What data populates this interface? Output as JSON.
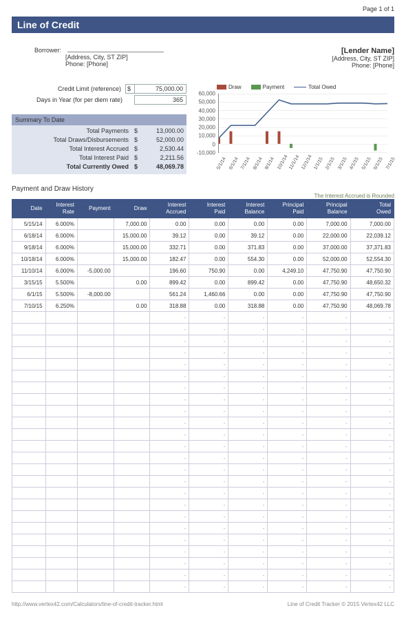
{
  "page_indicator": "Page 1 of 1",
  "title": "Line of Credit",
  "borrower": {
    "label": "Borrower:",
    "address": "[Address, City, ST ZIP]",
    "phone": "Phone: [Phone]"
  },
  "lender": {
    "name": "[Lender Name]",
    "address": "[Address, City, ST  ZIP]",
    "phone": "Phone: [Phone]"
  },
  "inputs": {
    "credit_limit_label": "Credit Limit (reference)",
    "credit_limit_currency": "$",
    "credit_limit_value": "75,000.00",
    "days_label": "Days in Year (for per diem rate)",
    "days_value": "365"
  },
  "summary": {
    "heading": "Summary To Date",
    "rows": [
      {
        "label": "Total Payments",
        "cur": "$",
        "value": "13,000.00"
      },
      {
        "label": "Total Draws/Disbursements",
        "cur": "$",
        "value": "52,000.00"
      },
      {
        "label": "Total Interest Accrued",
        "cur": "$",
        "value": "2,530.44"
      },
      {
        "label": "Total Interest Paid",
        "cur": "$",
        "value": "2,211.56"
      }
    ],
    "total": {
      "label": "Total Currently Owed",
      "cur": "$",
      "value": "48,069.78"
    }
  },
  "chart_data": {
    "type": "combo",
    "legend": {
      "draw": "Draw",
      "payment": "Payment",
      "total": "Total Owed"
    },
    "y_ticks": [
      "-10,000",
      "0",
      "10,000",
      "20,000",
      "30,000",
      "40,000",
      "50,000",
      "60,000"
    ],
    "ylim": [
      -10000,
      60000
    ],
    "x_categories": [
      "5/1/14",
      "6/1/14",
      "7/1/14",
      "8/1/14",
      "9/1/14",
      "10/1/14",
      "11/1/14",
      "12/1/14",
      "1/1/15",
      "2/1/15",
      "3/1/15",
      "4/1/15",
      "5/1/15",
      "6/1/15",
      "7/1/15"
    ],
    "draws": [
      7000,
      15000,
      0,
      0,
      15000,
      15000,
      0,
      0,
      0,
      0,
      0,
      0,
      0,
      0,
      0
    ],
    "payments": [
      0,
      0,
      0,
      0,
      0,
      0,
      5000,
      0,
      0,
      0,
      0,
      0,
      0,
      8000,
      0
    ],
    "total_owed": [
      7000,
      22039,
      22039,
      22039,
      37372,
      52554,
      47751,
      47751,
      47751,
      47751,
      48650,
      48650,
      48650,
      47751,
      48070
    ]
  },
  "history": {
    "title": "Payment and Draw History",
    "note": "The Interest Accrued is Rounded",
    "columns": [
      "Date",
      "Interest Rate",
      "Payment",
      "Draw",
      "Interest Accrued",
      "Interest Paid",
      "Interest Balance",
      "Principal Paid",
      "Principal Balance",
      "Total Owed"
    ],
    "rows": [
      {
        "date": "5/15/14",
        "rate": "6.000%",
        "payment": "",
        "draw": "7,000.00",
        "acc": "0.00",
        "ipaid": "0.00",
        "ibal": "0.00",
        "ppaid": "0.00",
        "pbal": "7,000.00",
        "owed": "7,000.00"
      },
      {
        "date": "6/18/14",
        "rate": "6.000%",
        "payment": "",
        "draw": "15,000.00",
        "acc": "39.12",
        "ipaid": "0.00",
        "ibal": "39.12",
        "ppaid": "0.00",
        "pbal": "22,000.00",
        "owed": "22,039.12"
      },
      {
        "date": "9/18/14",
        "rate": "6.000%",
        "payment": "",
        "draw": "15,000.00",
        "acc": "332.71",
        "ipaid": "0.00",
        "ibal": "371.83",
        "ppaid": "0.00",
        "pbal": "37,000.00",
        "owed": "37,371.83"
      },
      {
        "date": "10/18/14",
        "rate": "6.000%",
        "payment": "",
        "draw": "15,000.00",
        "acc": "182.47",
        "ipaid": "0.00",
        "ibal": "554.30",
        "ppaid": "0.00",
        "pbal": "52,000.00",
        "owed": "52,554.30"
      },
      {
        "date": "11/10/14",
        "rate": "6.000%",
        "payment": "-5,000.00",
        "draw": "",
        "acc": "196.60",
        "ipaid": "750.90",
        "ibal": "0.00",
        "ppaid": "4,249.10",
        "pbal": "47,750.90",
        "owed": "47,750.90"
      },
      {
        "date": "3/15/15",
        "rate": "5.500%",
        "payment": "",
        "draw": "0.00",
        "acc": "899.42",
        "ipaid": "0.00",
        "ibal": "899.42",
        "ppaid": "0.00",
        "pbal": "47,750.90",
        "owed": "48,650.32"
      },
      {
        "date": "6/1/15",
        "rate": "5.500%",
        "payment": "-8,000.00",
        "draw": "",
        "acc": "561.24",
        "ipaid": "1,460.66",
        "ibal": "0.00",
        "ppaid": "0.00",
        "pbal": "47,750.90",
        "owed": "47,750.90"
      },
      {
        "date": "7/10/15",
        "rate": "6.250%",
        "payment": "",
        "draw": "0.00",
        "acc": "318.88",
        "ipaid": "0.00",
        "ibal": "318.88",
        "ppaid": "0.00",
        "pbal": "47,750.90",
        "owed": "48,069.78"
      }
    ],
    "empty_row_count": 24
  },
  "footer": {
    "left": "http://www.vertex42.com/Calculators/line-of-credit-tracker.html",
    "right": "Line of Credit Tracker © 2015 Vertex42 LLC"
  }
}
